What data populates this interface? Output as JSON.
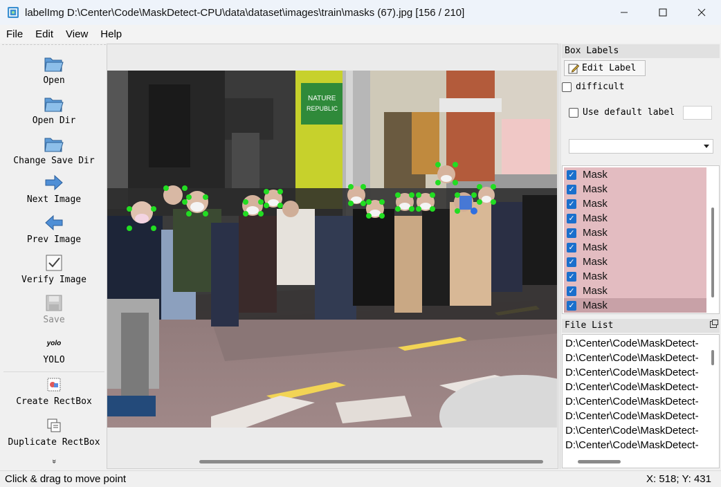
{
  "window": {
    "title": "labelImg D:\\Center\\Code\\MaskDetect-CPU\\data\\dataset\\images\\train\\masks (67).jpg [156 / 210]",
    "minimize_icon": "minimize-icon",
    "maximize_icon": "maximize-icon",
    "close_icon": "close-icon"
  },
  "menu": [
    "File",
    "Edit",
    "View",
    "Help"
  ],
  "toolbar": {
    "open": "Open",
    "open_dir": "Open Dir",
    "change_save_dir": "Change Save Dir",
    "next_image": "Next Image",
    "prev_image": "Prev Image",
    "verify_image": "Verify Image",
    "save": "Save",
    "yolo_icon_text": "yolo",
    "yolo": "YOLO",
    "create_rectbox": "Create RectBox",
    "duplicate_rectbox": "Duplicate RectBox",
    "more": "»"
  },
  "box_labels": {
    "title": "Box Labels",
    "edit_label": "Edit Label",
    "difficult": "difficult",
    "difficult_checked": false,
    "use_default_label": "Use default label",
    "use_default_label_checked": false,
    "default_label_value": "",
    "combo_value": "",
    "items": [
      {
        "label": "Mask",
        "checked": true,
        "selected": false
      },
      {
        "label": "Mask",
        "checked": true,
        "selected": false
      },
      {
        "label": "Mask",
        "checked": true,
        "selected": false
      },
      {
        "label": "Mask",
        "checked": true,
        "selected": false
      },
      {
        "label": "Mask",
        "checked": true,
        "selected": false
      },
      {
        "label": "Mask",
        "checked": true,
        "selected": false
      },
      {
        "label": "Mask",
        "checked": true,
        "selected": false
      },
      {
        "label": "Mask",
        "checked": true,
        "selected": false
      },
      {
        "label": "Mask",
        "checked": true,
        "selected": false
      },
      {
        "label": "Mask",
        "checked": true,
        "selected": true
      }
    ],
    "label_color": "#e3bcc1"
  },
  "file_list": {
    "title": "File List",
    "items": [
      "D:\\Center\\Code\\MaskDetect-",
      "D:\\Center\\Code\\MaskDetect-",
      "D:\\Center\\Code\\MaskDetect-",
      "D:\\Center\\Code\\MaskDetect-",
      "D:\\Center\\Code\\MaskDetect-",
      "D:\\Center\\Code\\MaskDetect-",
      "D:\\Center\\Code\\MaskDetect-",
      "D:\\Center\\Code\\MaskDetect-"
    ]
  },
  "photo": {
    "store_sign_line1": "NATURE",
    "store_sign_line2": "REPUBLIC"
  },
  "status": {
    "message": "Click & drag to move point",
    "coords": "X: 518; Y: 431"
  },
  "colors": {
    "point_color": "#22dd22",
    "active_point": "#2f6fe0"
  }
}
